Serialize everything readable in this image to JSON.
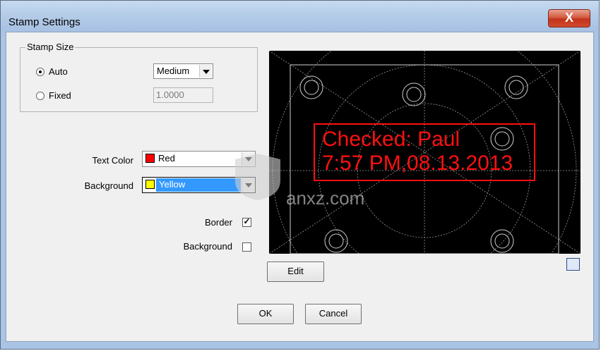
{
  "window": {
    "title": "Stamp Settings",
    "close_label": "X"
  },
  "stamp_size": {
    "legend": "Stamp Size",
    "auto_label": "Auto",
    "fixed_label": "Fixed",
    "selected": "Auto",
    "size_value": "Medium",
    "fixed_value": "1.0000"
  },
  "text_color": {
    "label": "Text Color",
    "value": "Red",
    "swatch": "#ff0000"
  },
  "background_color": {
    "label": "Background",
    "value": "Yellow",
    "swatch": "#ffff00",
    "highlight": "#3399ff"
  },
  "border_option": {
    "label": "Border",
    "checked": true
  },
  "background_option": {
    "label": "Background",
    "checked": false
  },
  "preview": {
    "line1": "Checked: Paul",
    "line2": "7:57 PM,08.13.2013",
    "stamp_color": "#ff1010",
    "watermark": "anxz.com"
  },
  "buttons": {
    "edit": "Edit",
    "ok": "OK",
    "cancel": "Cancel"
  }
}
